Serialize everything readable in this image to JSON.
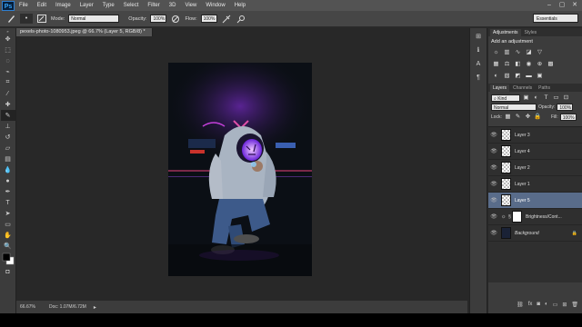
{
  "app": {
    "logo": "Ps"
  },
  "menu": [
    "File",
    "Edit",
    "Image",
    "Layer",
    "Type",
    "Select",
    "Filter",
    "3D",
    "View",
    "Window",
    "Help"
  ],
  "window_controls": [
    "–",
    "▢",
    "✕"
  ],
  "options": {
    "mode_label": "Mode:",
    "mode_value": "Normal",
    "opacity_label": "Opacity:",
    "opacity_value": "100%",
    "flow_label": "Flow:",
    "flow_value": "100%",
    "workspace": "Essentials"
  },
  "document": {
    "tab_title": "pexels-photo-1080953.jpeg @ 66.7% (Layer 5, RGB/8) *",
    "zoom": "66.67%",
    "doc_info": "Doc: 1.07M/6.72M"
  },
  "adjustments_panel": {
    "tabs": [
      "Adjustments",
      "Styles"
    ],
    "title": "Add an adjustment"
  },
  "layers_panel": {
    "tabs": [
      "Layers",
      "Channels",
      "Paths"
    ],
    "kind_label": "Kind",
    "blend_mode": "Normal",
    "opacity_label": "Opacity:",
    "opacity_value": "100%",
    "lock_label": "Lock:",
    "fill_label": "Fill:",
    "fill_value": "100%",
    "layers": [
      {
        "name": "Layer 3"
      },
      {
        "name": "Layer 4"
      },
      {
        "name": "Layer 2"
      },
      {
        "name": "Layer 1"
      },
      {
        "name": "Layer 5"
      },
      {
        "name": "Brightness/Cont..."
      },
      {
        "name": "Background"
      }
    ]
  }
}
